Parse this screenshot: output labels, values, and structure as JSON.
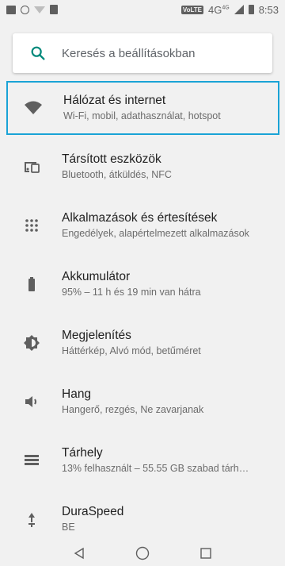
{
  "status_bar": {
    "network_badge": "VoLTE",
    "network_type": "4G",
    "network_sup": "4G",
    "time": "8:53"
  },
  "search": {
    "placeholder": "Keresés a beállításokban",
    "icon": "search-icon",
    "accent_color": "#00897b"
  },
  "settings": {
    "items": [
      {
        "icon": "wifi-icon",
        "title": "Hálózat és internet",
        "subtitle": "Wi-Fi, mobil, adathasználat, hotspot",
        "selected": true
      },
      {
        "icon": "connected-devices-icon",
        "title": "Társított eszközök",
        "subtitle": "Bluetooth, átküldés, NFC"
      },
      {
        "icon": "apps-grid-icon",
        "title": "Alkalmazások és értesítések",
        "subtitle": "Engedélyek, alapértelmezett alkalmazások"
      },
      {
        "icon": "battery-icon",
        "title": "Akkumulátor",
        "subtitle": "95% – 11 h és 19 min van hátra"
      },
      {
        "icon": "brightness-icon",
        "title": "Megjelenítés",
        "subtitle": "Háttérkép, Alvó mód, betűméret"
      },
      {
        "icon": "volume-icon",
        "title": "Hang",
        "subtitle": "Hangerő, rezgés, Ne zavarjanak"
      },
      {
        "icon": "storage-icon",
        "title": "Tárhely",
        "subtitle": "13% felhasznált – 55.55 GB szabad tárh…"
      },
      {
        "icon": "duraspeed-icon",
        "title": "DuraSpeed",
        "subtitle": "BE"
      }
    ]
  },
  "selection_color": "#1aa3d6",
  "nav_bar": {
    "back": "back-icon",
    "home": "home-icon",
    "recents": "recents-icon"
  }
}
